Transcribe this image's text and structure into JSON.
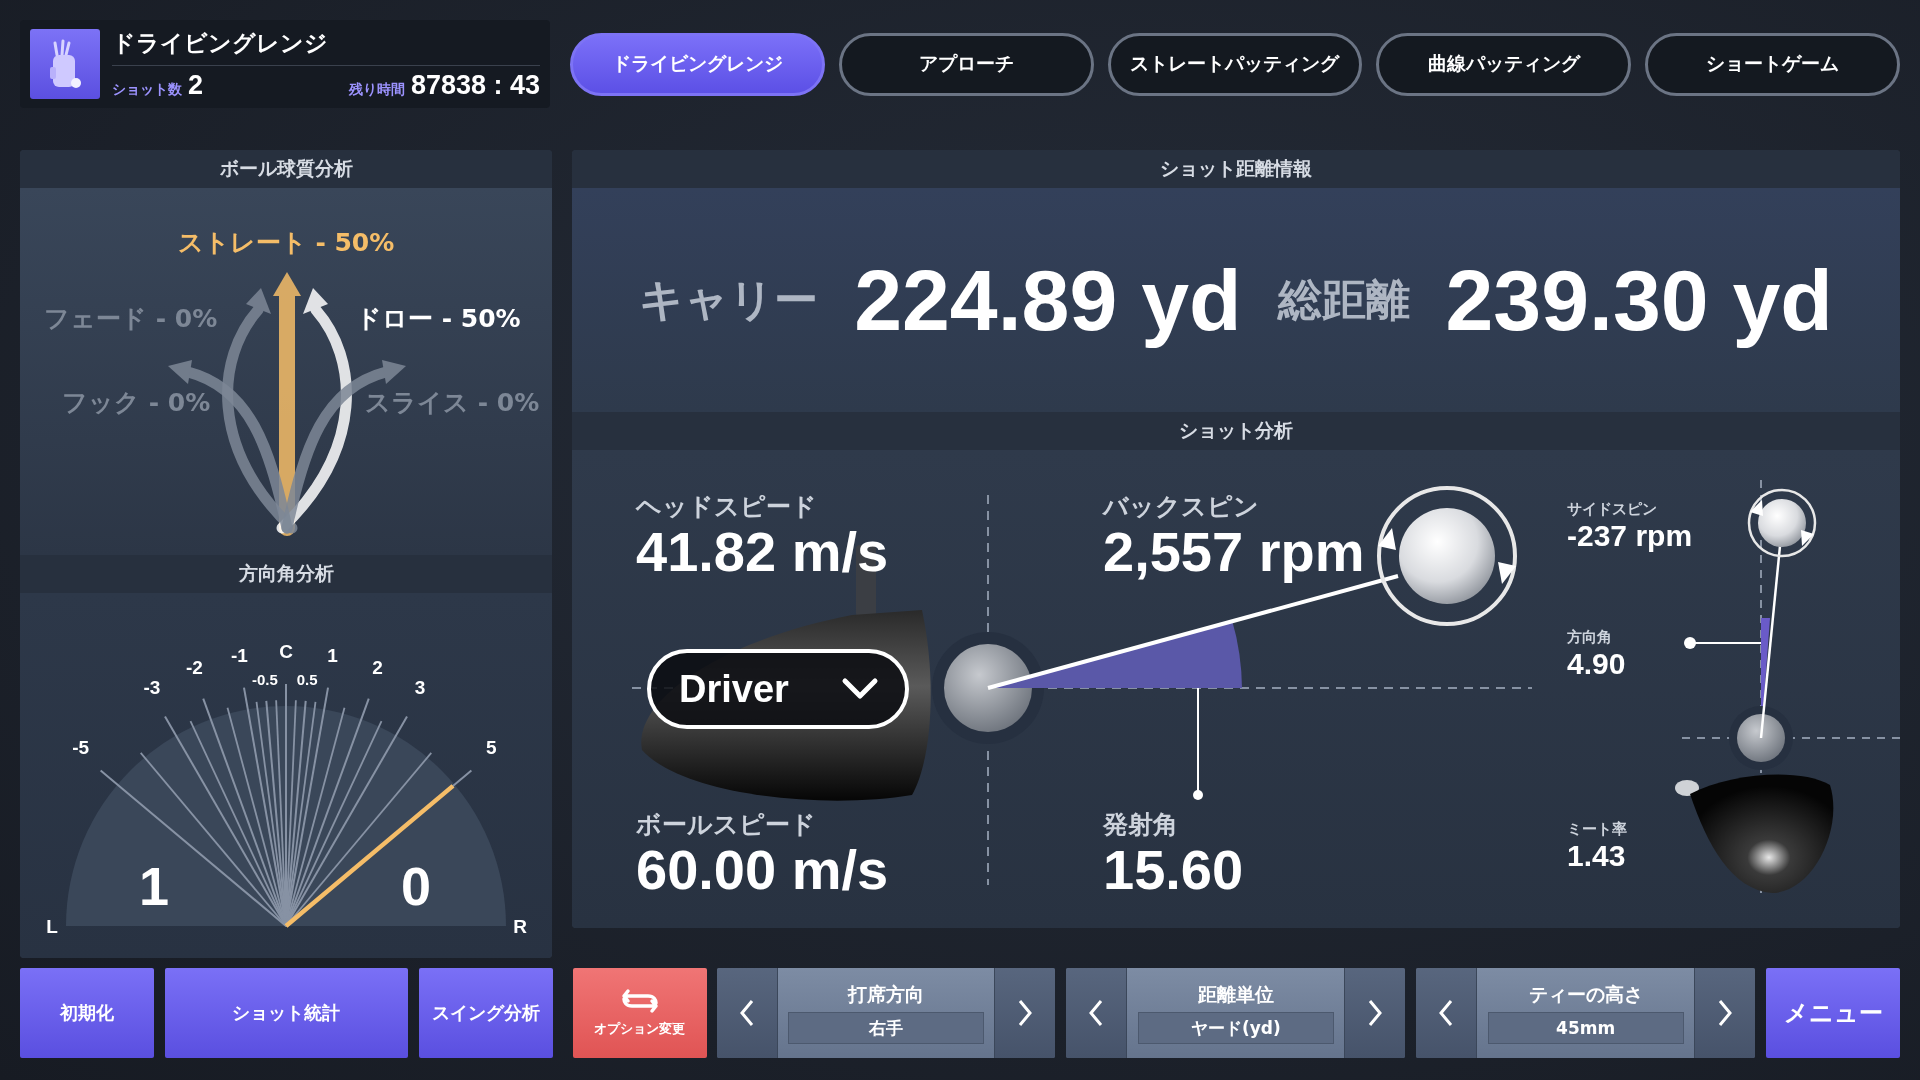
{
  "header": {
    "mode": "ドライビングレンジ",
    "shots_label": "ショット数",
    "shots": "2",
    "time_label": "残り時間",
    "time": "87838 : 43"
  },
  "tabs": [
    {
      "label": "ドライビングレンジ",
      "selected": true
    },
    {
      "label": "アプローチ",
      "selected": false
    },
    {
      "label": "ストレートパッティング",
      "selected": false
    },
    {
      "label": "曲線パッティング",
      "selected": false
    },
    {
      "label": "ショートゲーム",
      "selected": false
    }
  ],
  "ball_quality": {
    "title": "ボール球質分析",
    "shapes": [
      {
        "kind": "straight",
        "label": "ストレート - 50%",
        "color": "#f5bd68"
      },
      {
        "kind": "fade",
        "label": "フェード - 0%",
        "color": "#7d8796"
      },
      {
        "kind": "draw",
        "label": "ドロー - 50%",
        "color": "#ffffff"
      },
      {
        "kind": "hook",
        "label": "フック - 0%",
        "color": "#7d8796"
      },
      {
        "kind": "slice",
        "label": "スライス - 0%",
        "color": "#7d8796"
      }
    ]
  },
  "direction_analysis": {
    "title": "方向角分析",
    "ticks": [
      {
        "label": "-5",
        "kind": "major",
        "highlighted": false
      },
      {
        "label": "-3",
        "kind": "major",
        "highlighted": false
      },
      {
        "label": "-2",
        "kind": "major",
        "highlighted": false
      },
      {
        "label": "-1",
        "kind": "major",
        "highlighted": false
      },
      {
        "label": "-0.5",
        "kind": "minor",
        "highlighted": false
      },
      {
        "label": "C",
        "kind": "major",
        "highlighted": false
      },
      {
        "label": "0.5",
        "kind": "minor",
        "highlighted": false
      },
      {
        "label": "1",
        "kind": "major",
        "highlighted": false
      },
      {
        "label": "2",
        "kind": "major",
        "highlighted": false
      },
      {
        "label": "3",
        "kind": "major",
        "highlighted": false
      },
      {
        "label": "5",
        "kind": "major",
        "highlighted": true
      }
    ],
    "left_label": "L",
    "right_label": "R",
    "left_count": "1",
    "right_count": "0"
  },
  "shot_distance": {
    "title": "ショット距離情報",
    "carry_label": "キャリー",
    "carry": "224.89 yd",
    "total_label": "総距離",
    "total": "239.30 yd"
  },
  "shot_analysis": {
    "title": "ショット分析",
    "club": "Driver",
    "head_speed": {
      "label": "ヘッドスピード",
      "value": "41.82 m/s"
    },
    "ball_speed": {
      "label": "ボールスピード",
      "value": "60.00 m/s"
    },
    "back_spin": {
      "label": "バックスピン",
      "value": "2,557 rpm"
    },
    "launch_angle": {
      "label": "発射角",
      "value": "15.60"
    },
    "side_spin": {
      "label": "サイドスピン",
      "value": "-237 rpm"
    },
    "direction_angle": {
      "label": "方向角",
      "value": "4.90"
    },
    "smash_factor": {
      "label": "ミート率",
      "value": "1.43"
    }
  },
  "bottom_bar": {
    "buttons": [
      "初期化",
      "ショット統計",
      "スイング分析"
    ],
    "option_button": "オプション変更",
    "selectors": [
      {
        "title": "打席方向",
        "value": "右手"
      },
      {
        "title": "距離単位",
        "value": "ヤード(yd)"
      },
      {
        "title": "ティーの高さ",
        "value": "45mm"
      }
    ],
    "menu_button": "メニュー"
  }
}
